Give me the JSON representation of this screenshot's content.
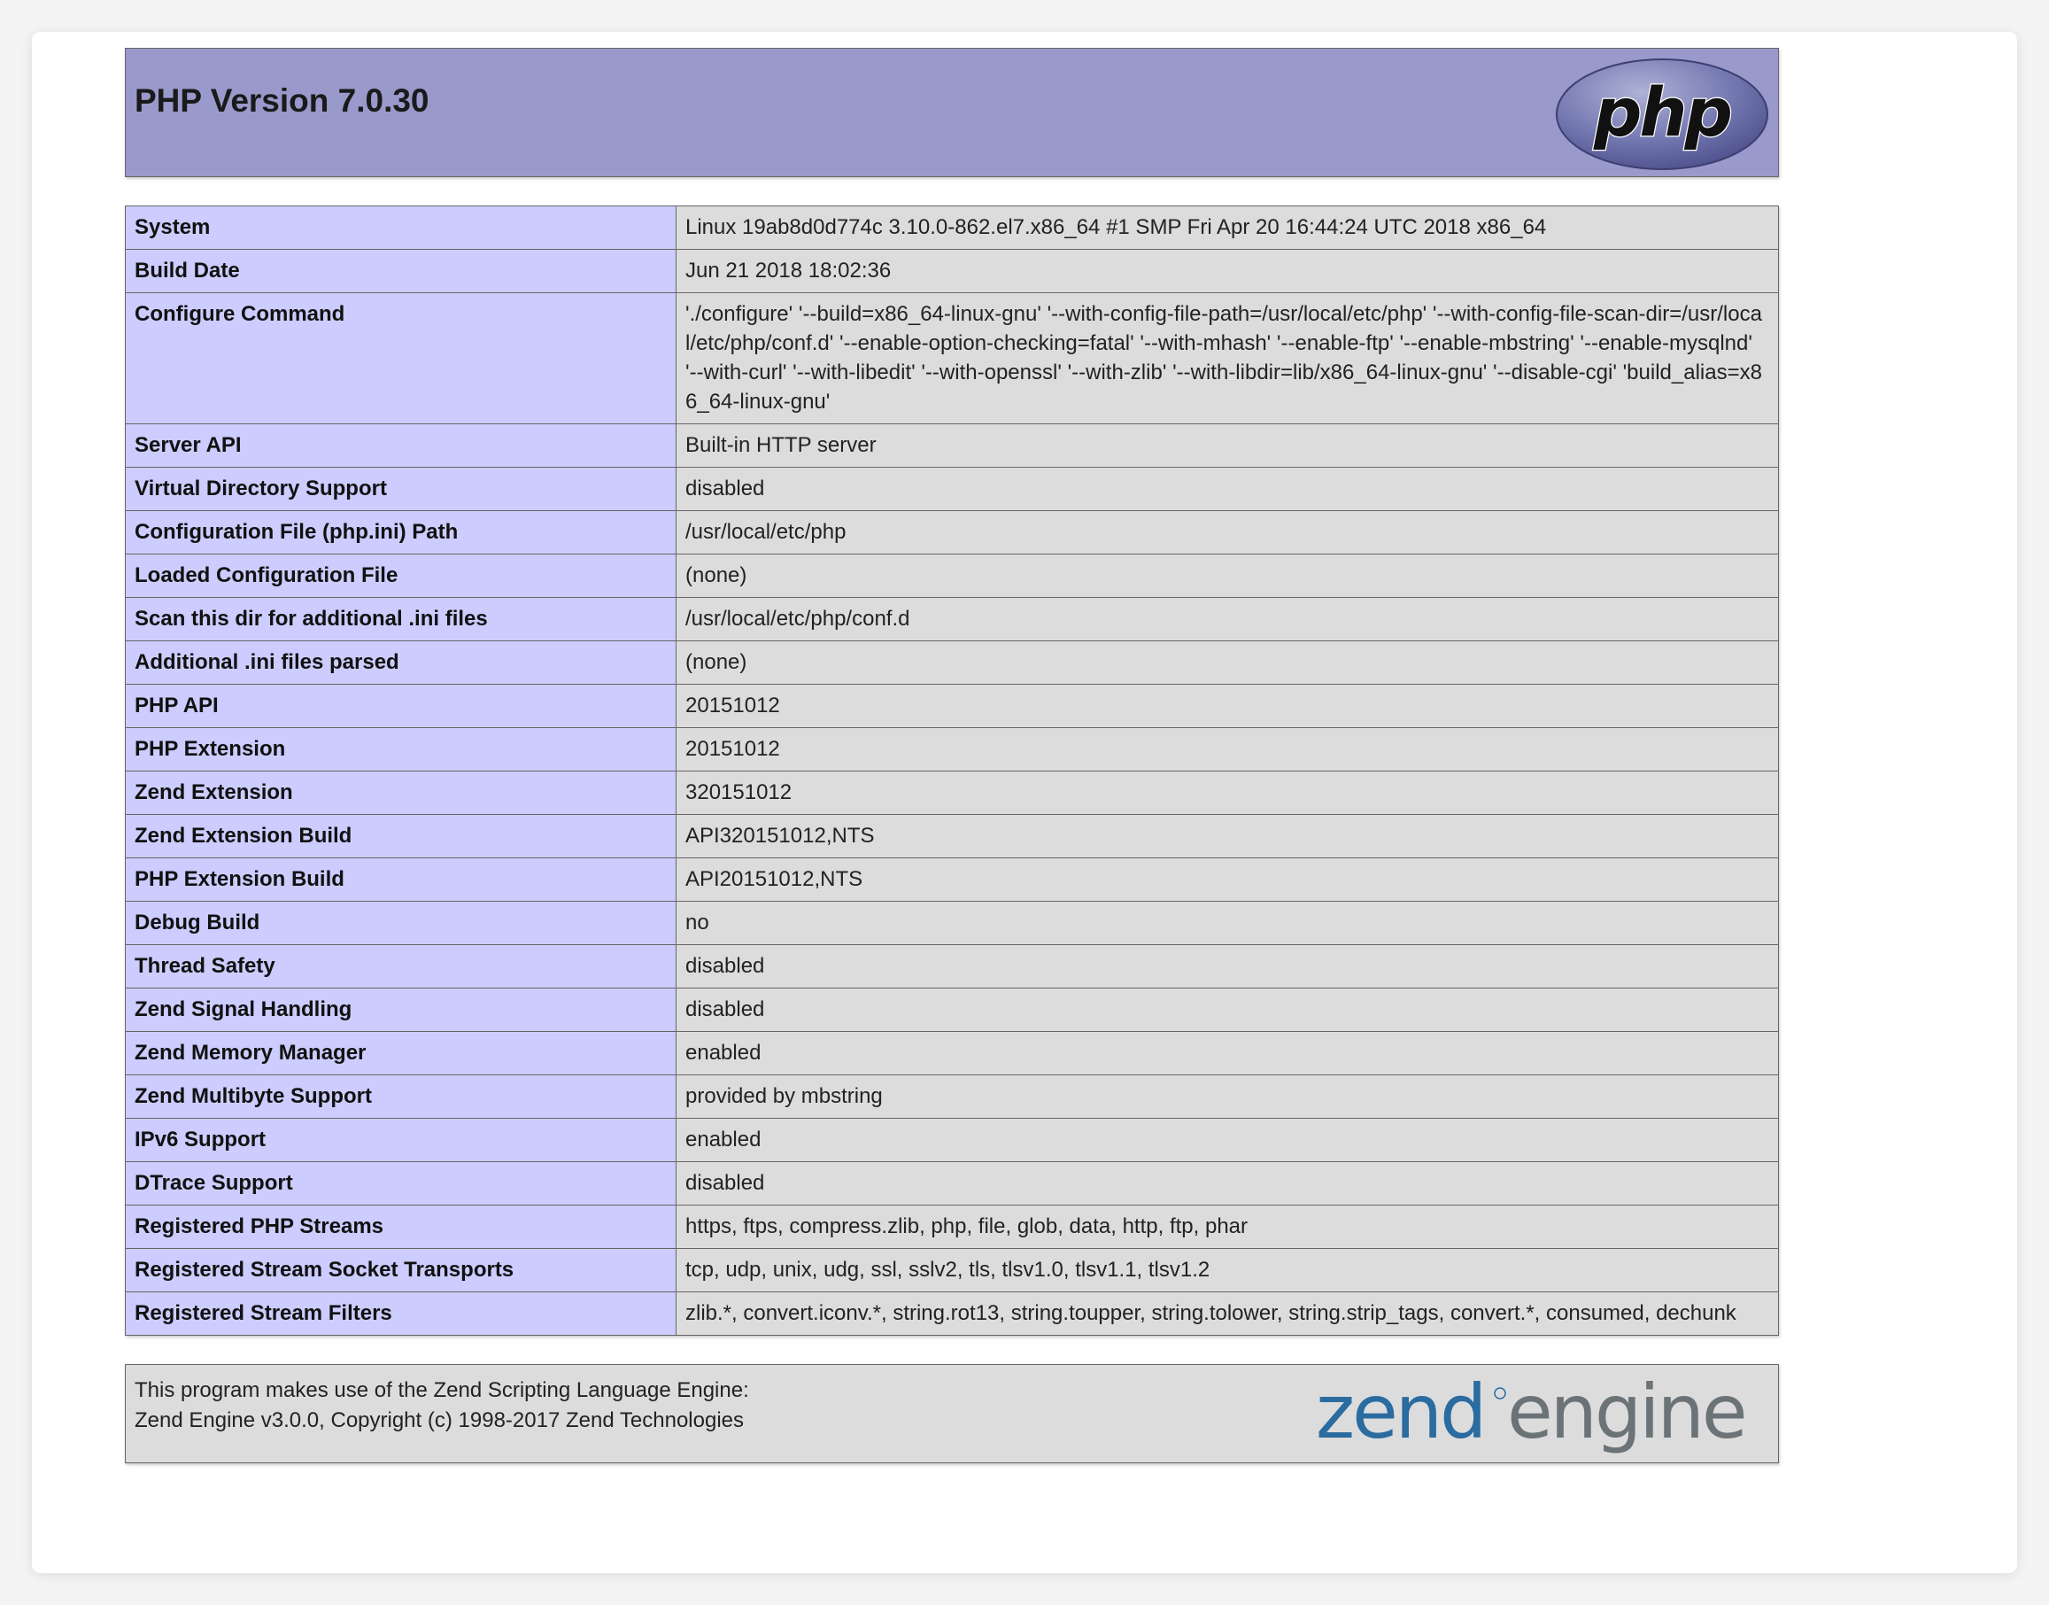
{
  "header": {
    "title": "PHP Version 7.0.30",
    "logo_text": "php"
  },
  "rows": [
    {
      "label": "System",
      "value": "Linux 19ab8d0d774c 3.10.0-862.el7.x86_64 #1 SMP Fri Apr 20 16:44:24 UTC 2018 x86_64"
    },
    {
      "label": "Build Date",
      "value": "Jun 21 2018 18:02:36"
    },
    {
      "label": "Configure Command",
      "value": "'./configure' '--build=x86_64-linux-gnu' '--with-config-file-path=/usr/local/etc/php' '--with-config-file-scan-dir=/usr/local/etc/php/conf.d' '--enable-option-checking=fatal' '--with-mhash' '--enable-ftp' '--enable-mbstring' '--enable-mysqlnd' '--with-curl' '--with-libedit' '--with-openssl' '--with-zlib' '--with-libdir=lib/x86_64-linux-gnu' '--disable-cgi' 'build_alias=x86_64-linux-gnu'"
    },
    {
      "label": "Server API",
      "value": "Built-in HTTP server"
    },
    {
      "label": "Virtual Directory Support",
      "value": "disabled"
    },
    {
      "label": "Configuration File (php.ini) Path",
      "value": "/usr/local/etc/php"
    },
    {
      "label": "Loaded Configuration File",
      "value": "(none)"
    },
    {
      "label": "Scan this dir for additional .ini files",
      "value": "/usr/local/etc/php/conf.d"
    },
    {
      "label": "Additional .ini files parsed",
      "value": "(none)"
    },
    {
      "label": "PHP API",
      "value": "20151012"
    },
    {
      "label": "PHP Extension",
      "value": "20151012"
    },
    {
      "label": "Zend Extension",
      "value": "320151012"
    },
    {
      "label": "Zend Extension Build",
      "value": "API320151012,NTS"
    },
    {
      "label": "PHP Extension Build",
      "value": "API20151012,NTS"
    },
    {
      "label": "Debug Build",
      "value": "no"
    },
    {
      "label": "Thread Safety",
      "value": "disabled"
    },
    {
      "label": "Zend Signal Handling",
      "value": "disabled"
    },
    {
      "label": "Zend Memory Manager",
      "value": "enabled"
    },
    {
      "label": "Zend Multibyte Support",
      "value": "provided by mbstring"
    },
    {
      "label": "IPv6 Support",
      "value": "enabled"
    },
    {
      "label": "DTrace Support",
      "value": "disabled"
    },
    {
      "label": "Registered PHP Streams",
      "value": "https, ftps, compress.zlib, php, file, glob, data, http, ftp, phar"
    },
    {
      "label": "Registered Stream Socket Transports",
      "value": "tcp, udp, unix, udg, ssl, sslv2, tls, tlsv1.0, tlsv1.1, tlsv1.2"
    },
    {
      "label": "Registered Stream Filters",
      "value": "zlib.*, convert.iconv.*, string.rot13, string.toupper, string.tolower, string.strip_tags, convert.*, consumed, dechunk"
    }
  ],
  "footer": {
    "line1": "This program makes use of the Zend Scripting Language Engine:",
    "line2": "Zend Engine v3.0.0, Copyright (c) 1998-2017 Zend Technologies",
    "logo_zend": "zend",
    "logo_engine": "engine"
  },
  "colors": {
    "header_bg": "#9999cc",
    "label_bg": "#ccccff",
    "value_bg": "#dcdcdc",
    "zend_blue": "#2a6ba0",
    "engine_gray": "#6b7377"
  }
}
